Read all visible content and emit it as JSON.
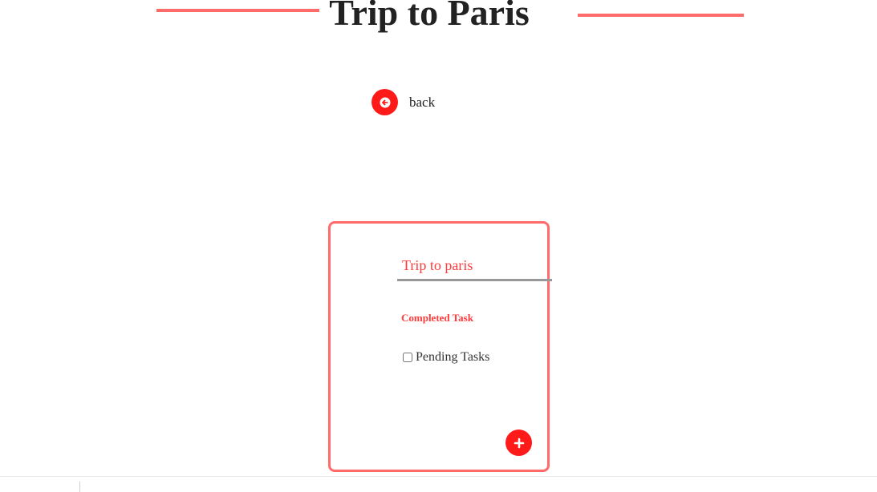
{
  "page": {
    "title": "Trip to Paris"
  },
  "nav": {
    "back_label": "back",
    "back_icon": "arrow-left-icon"
  },
  "card": {
    "list_name_value": "Trip to paris",
    "completed_heading": "Completed Task",
    "tasks": [
      {
        "label": "Pending Tasks",
        "checked": false
      }
    ],
    "add_icon": "plus-icon"
  },
  "colors": {
    "accent": "#ff1a1a",
    "line": "#ff6b6b"
  }
}
